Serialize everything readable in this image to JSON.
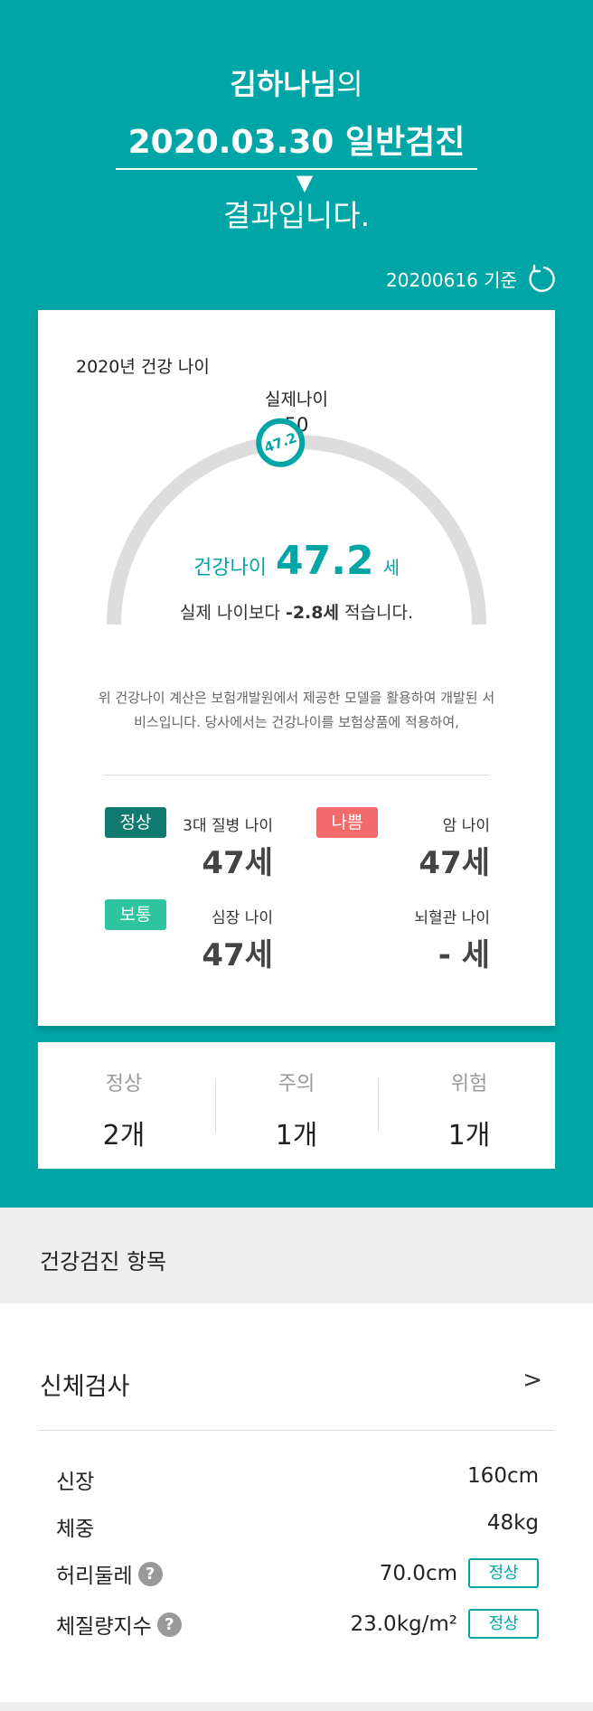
{
  "header": {
    "name": "김하나님",
    "name_suffix": "의",
    "exam_select": "2020.03.30 일반검진",
    "result_text": "결과입니다.",
    "as_of": "20200616 기준"
  },
  "health_age_card": {
    "year_title": "2020년 건강 나이",
    "real_age_label": "실제나이",
    "real_age_value": "50",
    "marker_value": "47.2",
    "health_age_label": "건강나이",
    "health_age_value": "47.2",
    "health_age_unit": "세",
    "diff_prefix": "실제 나이보다",
    "diff_value": "-2.8세",
    "diff_suffix": "적습니다.",
    "note": "위 건강나이 계산은 보험개발원에서 제공한 모델을 활용하여 개발된 서비스입니다. 당사에서는 건강나이를 보험상품에 적용하여,",
    "gauge": {
      "min_age": 0,
      "real_age": 50,
      "health_age": 47.2
    },
    "metrics": [
      {
        "badge": "정상",
        "badge_color": "#117A6E",
        "label": "3대 질병 나이",
        "value": "47세"
      },
      {
        "badge": "나쁨",
        "badge_color": "#F26A6A",
        "label": "암 나이",
        "value": "47세"
      },
      {
        "badge": "보통",
        "badge_color": "#2EC4A0",
        "label": "심장 나이",
        "value": "47세"
      },
      {
        "badge": "",
        "badge_color": "",
        "label": "뇌혈관 나이",
        "value": "- 세"
      }
    ]
  },
  "summary": [
    {
      "label": "정상",
      "value": "2개"
    },
    {
      "label": "주의",
      "value": "1개"
    },
    {
      "label": "위험",
      "value": "1개"
    }
  ],
  "section": {
    "title": "건강검진 항목",
    "group_title": "신체검사",
    "rows": [
      {
        "label": "신장",
        "value": "160cm",
        "help": false,
        "status": ""
      },
      {
        "label": "체중",
        "value": "48kg",
        "help": false,
        "status": ""
      },
      {
        "label": "허리둘레",
        "value": "70.0cm",
        "help": true,
        "status": "정상"
      },
      {
        "label": "체질량지수",
        "value": "23.0kg/m²",
        "help": true,
        "status": "정상"
      }
    ]
  },
  "colors": {
    "accent": "#00A6A6",
    "gauge_track": "#DDDDDD",
    "gauge_fill": "#6CC4C8"
  }
}
